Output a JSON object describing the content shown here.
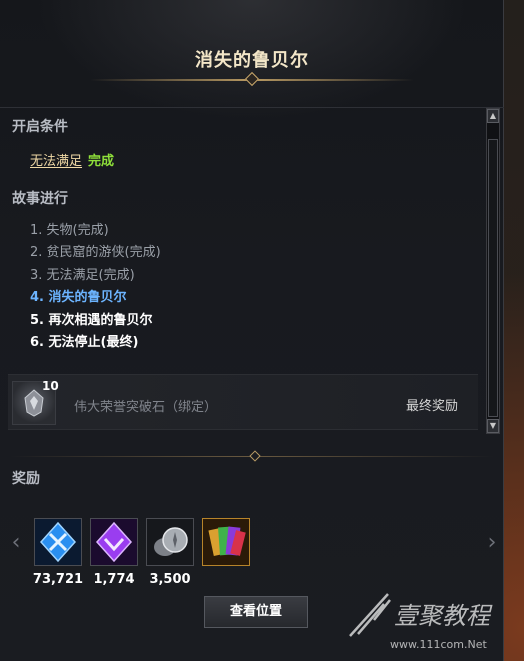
{
  "window": {
    "title": "消失的鲁贝尔"
  },
  "conditions": {
    "header": "开启条件",
    "item_text": "无法满足",
    "item_status": "完成"
  },
  "story": {
    "header": "故事进行",
    "items": [
      {
        "label": "1. 失物(完成)",
        "state": "done"
      },
      {
        "label": "2. 贫民窟的游侠(完成)",
        "state": "done"
      },
      {
        "label": "3. 无法满足(完成)",
        "state": "done"
      },
      {
        "label": "4. 消失的鲁贝尔",
        "state": "current"
      },
      {
        "label": "5. 再次相遇的鲁贝尔",
        "state": "future"
      },
      {
        "label": "6. 无法停止(最终)",
        "state": "future"
      }
    ]
  },
  "final_reward": {
    "quantity": "10",
    "name": "伟大荣誉突破石（绑定）",
    "label": "最终奖励",
    "icon": "honor-stone-icon"
  },
  "rewards": {
    "header": "奖励",
    "items": [
      {
        "icon": "blue-crystal-icon",
        "quantity": "73,721",
        "color": "#2a8ff0"
      },
      {
        "icon": "purple-crystal-icon",
        "quantity": "1,774",
        "color": "#9a3df0"
      },
      {
        "icon": "silver-coin-icon",
        "quantity": "3,500",
        "color": "#a8adb3"
      },
      {
        "icon": "card-pack-icon",
        "quantity": "",
        "color": "#d9a030"
      }
    ],
    "button_label": "查看位置"
  },
  "watermark": {
    "text": "壹聚教程",
    "url": "www.111com.Net"
  }
}
